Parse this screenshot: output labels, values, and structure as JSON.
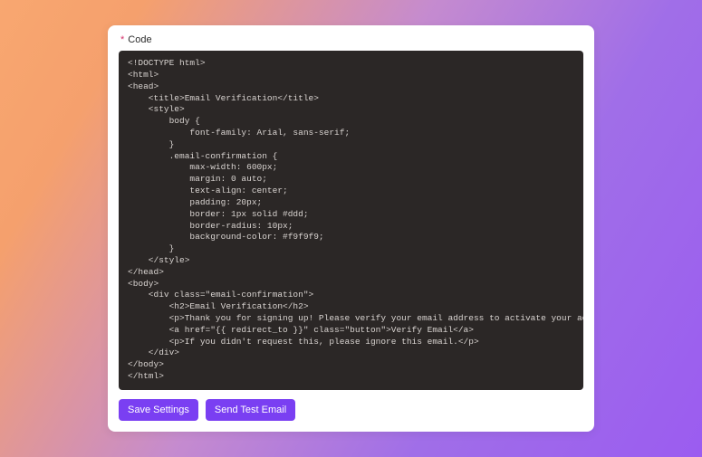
{
  "field": {
    "label": "Code",
    "required_marker": "*"
  },
  "code": {
    "content": "<!DOCTYPE html>\n<html>\n<head>\n    <title>Email Verification</title>\n    <style>\n        body {\n            font-family: Arial, sans-serif;\n        }\n        .email-confirmation {\n            max-width: 600px;\n            margin: 0 auto;\n            text-align: center;\n            padding: 20px;\n            border: 1px solid #ddd;\n            border-radius: 10px;\n            background-color: #f9f9f9;\n        }\n    </style>\n</head>\n<body>\n    <div class=\"email-confirmation\">\n        <h2>Email Verification</h2>\n        <p>Thank you for signing up! Please verify your email address to activate your account.</p>\n        <a href=\"{{ redirect_to }}\" class=\"button\">Verify Email</a>\n        <p>If you didn't request this, please ignore this email.</p>\n    </div>\n</body>\n</html>"
  },
  "buttons": {
    "save": "Save Settings",
    "send_test": "Send Test Email"
  },
  "colors": {
    "accent": "#7a3ff2",
    "code_bg": "#2b2726",
    "code_fg": "#d9d4d1"
  }
}
